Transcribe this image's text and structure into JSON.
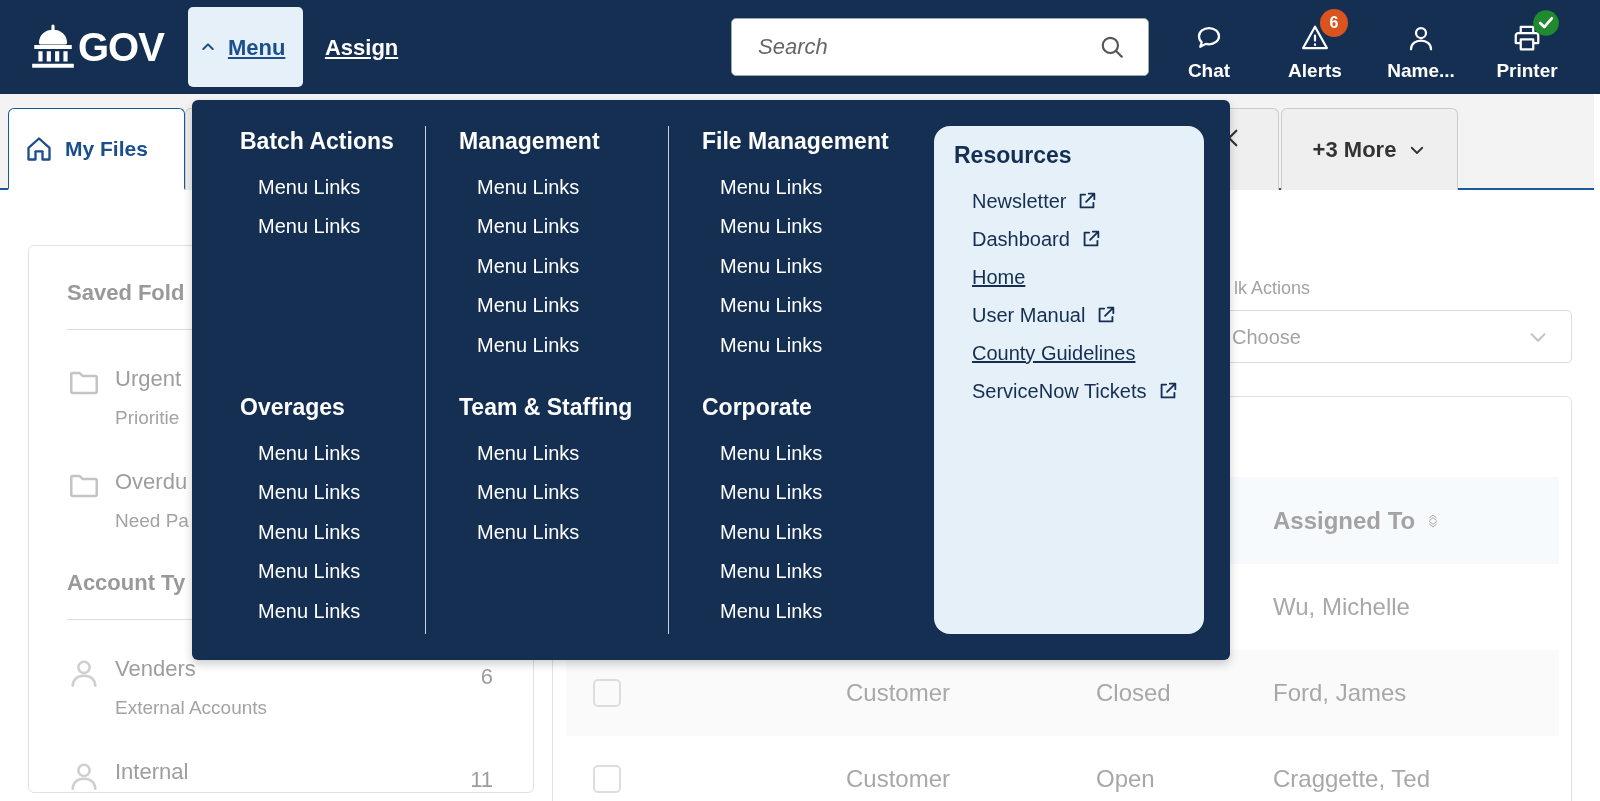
{
  "header": {
    "logo": "GOV",
    "nav": [
      {
        "kind": "dropdown",
        "label": "Menu",
        "expanded": true
      },
      {
        "kind": "link",
        "label": "Assign"
      }
    ],
    "search": {
      "placeholder": "Search"
    },
    "actions": [
      {
        "kind": "chat",
        "label": "Chat"
      },
      {
        "kind": "alerts",
        "label": "Alerts",
        "badge": "6"
      },
      {
        "kind": "user",
        "label": "Name..."
      },
      {
        "kind": "printer",
        "label": "Printer",
        "verified": true
      }
    ]
  },
  "tabs": [
    {
      "kind": "home",
      "label": "My Files",
      "selected": true
    },
    {
      "kind": "closable",
      "selected": false
    }
  ],
  "more_tabs": {
    "label": "+3 More"
  },
  "menu": {
    "columns": [
      [
        {
          "title": "Batch Actions",
          "links": [
            "Menu Links",
            "Menu Links"
          ]
        },
        {
          "title": "Overages",
          "links": [
            "Menu Links",
            "Menu Links",
            "Menu Links",
            "Menu Links",
            "Menu Links"
          ]
        }
      ],
      [
        {
          "title": "Management",
          "links": [
            "Menu Links",
            "Menu Links",
            "Menu Links",
            "Menu Links",
            "Menu Links"
          ]
        },
        {
          "title": "Team & Staffing",
          "links": [
            "Menu Links",
            "Menu Links",
            "Menu Links"
          ]
        }
      ],
      [
        {
          "title": "File Management",
          "links": [
            "Menu Links",
            "Menu Links",
            "Menu Links",
            "Menu Links",
            "Menu Links"
          ]
        },
        {
          "title": "Corporate",
          "links": [
            "Menu Links",
            "Menu Links",
            "Menu Links",
            "Menu Links",
            "Menu Links"
          ]
        }
      ]
    ],
    "resources": {
      "title": "Resources",
      "links": [
        {
          "label": "Newsletter",
          "external": true,
          "underlined": false
        },
        {
          "label": "Dashboard",
          "external": true,
          "underlined": false
        },
        {
          "label": "Home",
          "external": false,
          "underlined": true
        },
        {
          "label": "User Manual",
          "external": true,
          "underlined": false
        },
        {
          "label": "County Guidelines",
          "external": false,
          "underlined": true
        },
        {
          "label": "ServiceNow Tickets",
          "external": true,
          "underlined": false
        }
      ]
    }
  },
  "sidebar": {
    "sections": [
      {
        "title": "Saved Fold",
        "items": [
          {
            "kind": "folder",
            "name": "Urgent",
            "sub": "Prioritie"
          },
          {
            "kind": "folder",
            "name": "Overdu",
            "sub": "Need Pa"
          }
        ]
      },
      {
        "title": "Account Ty",
        "items": [
          {
            "kind": "user",
            "name": "Venders",
            "sub": "External Accounts",
            "count": "6"
          },
          {
            "kind": "user",
            "name": "Internal",
            "count": "11"
          }
        ]
      }
    ]
  },
  "bulk_actions": {
    "label": "lk Actions",
    "placeholder": "Choose"
  },
  "table": {
    "columns": [
      {
        "label": "Assigned To",
        "sortable": true
      }
    ],
    "rows": [
      {
        "assigned_to": "Wu, Michelle"
      },
      {
        "checked": false,
        "column_2": "Customer",
        "column_3": "Closed",
        "assigned_to": "Ford, James"
      },
      {
        "checked": false,
        "column_2": "Customer",
        "column_3": "Open",
        "assigned_to": "Craggette, Ted"
      }
    ]
  }
}
